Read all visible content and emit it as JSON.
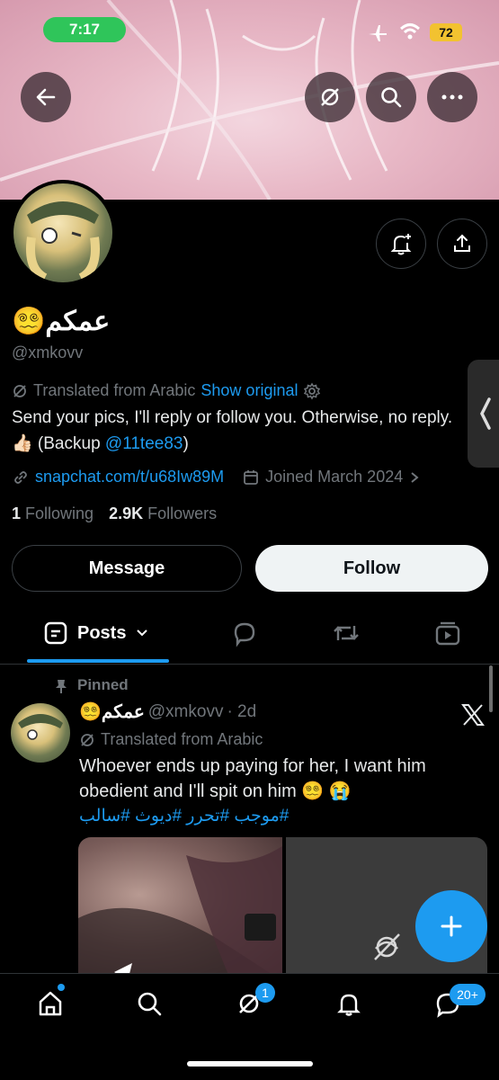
{
  "status_bar": {
    "time": "7:17",
    "battery": "72"
  },
  "profile": {
    "display_name": "عمكم",
    "name_emoji": "😵‍💫",
    "handle": "@xmkovv",
    "translated_label": "Translated from Arabic",
    "show_original": "Show original",
    "bio_text": "Send your pics, I'll reply or follow you. Otherwise, no reply. 👍🏻 (Backup ",
    "bio_mention": "@11tee83",
    "bio_end": ")",
    "link": "snapchat.com/t/u68Iw89M",
    "joined": "Joined March 2024",
    "following_count": "1",
    "following_label": "Following",
    "followers_count": "2.9K",
    "followers_label": "Followers"
  },
  "buttons": {
    "message": "Message",
    "follow": "Follow"
  },
  "tabs": {
    "posts": "Posts"
  },
  "tweet": {
    "pinned_label": "Pinned",
    "name": "عمكم",
    "name_emoji": "😵‍💫",
    "handle": "@xmkovv",
    "time": "· 2d",
    "translated_label": "Translated from Arabic",
    "text": "Whoever ends up paying for her, I want him obedient and I'll spit on him 😵‍💫 😭",
    "hashtags": "#موجب #تحرر #ديوث #سالب"
  },
  "nav": {
    "chat_badge": "1",
    "messages_badge": "20+"
  },
  "colors": {
    "accent": "#1d9bf0",
    "background": "#000000",
    "status_green": "#2fc55a"
  }
}
